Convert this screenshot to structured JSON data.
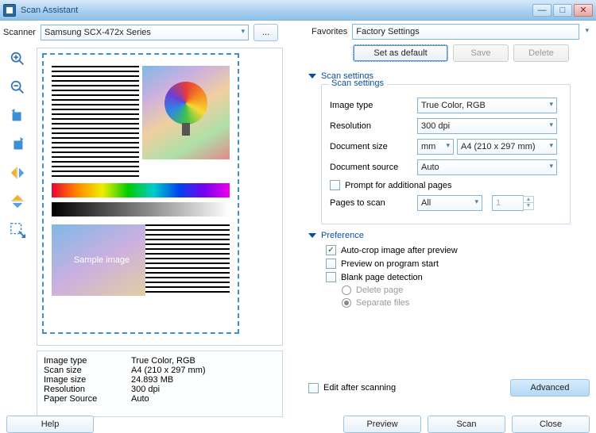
{
  "title": "Scan Assistant",
  "top": {
    "scanner_label": "Scanner",
    "scanner_value": "Samsung SCX-472x Series",
    "browse": "...",
    "favorites_label": "Favorites",
    "favorites_value": "Factory Settings",
    "set_default": "Set as default",
    "save": "Save",
    "delete": "Delete"
  },
  "sections": {
    "scan_h": "Scan settings",
    "scan_legend": "Scan settings",
    "pref_h": "Preference"
  },
  "scan": {
    "image_type_l": "Image type",
    "image_type_v": "True Color, RGB",
    "resolution_l": "Resolution",
    "resolution_v": "300 dpi",
    "docsize_l": "Document size",
    "docsize_unit": "mm",
    "docsize_v": "A4 (210 x 297 mm)",
    "docsource_l": "Document source",
    "docsource_v": "Auto",
    "prompt_l": "Prompt for additional pages",
    "pages_l": "Pages to scan",
    "pages_v": "All",
    "pages_n": "1"
  },
  "pref": {
    "autocrop": "Auto-crop image after preview",
    "preview_start": "Preview on program start",
    "blank": "Blank page detection",
    "deletepg": "Delete page",
    "sepfiles": "Separate files"
  },
  "info": {
    "image_type_k": "Image type",
    "image_type_v": "True Color, RGB",
    "scan_size_k": "Scan size",
    "scan_size_v": "A4 (210 x 297 mm)",
    "image_size_k": "Image size",
    "image_size_v": "24.893 MB",
    "resolution_k": "Resolution",
    "resolution_v": "300 dpi",
    "paper_src_k": "Paper Source",
    "paper_src_v": "Auto"
  },
  "bottom": {
    "edit_after": "Edit after scanning",
    "advanced": "Advanced",
    "help": "Help",
    "preview": "Preview",
    "scan": "Scan",
    "close": "Close"
  },
  "sample_text": "Sample image"
}
